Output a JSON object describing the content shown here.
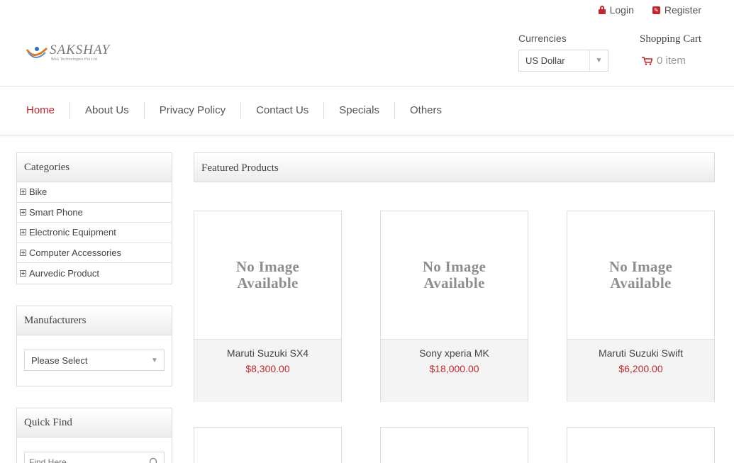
{
  "header": {
    "login_label": "Login",
    "register_label": "Register",
    "logo_text": "SAKSHAY",
    "logo_subtext": "Web Technologies Pvt Ltd",
    "currencies_label": "Currencies",
    "currency_selected": "US Dollar",
    "cart_title": "Shopping Cart",
    "cart_items": "0 item"
  },
  "nav": {
    "items": [
      "Home",
      "About Us",
      "Privacy Policy",
      "Contact Us",
      "Specials",
      "Others"
    ],
    "active": "Home"
  },
  "sidebar": {
    "categories_title": "Categories",
    "categories": [
      "Bike",
      "Smart Phone",
      "Electronic Equipment",
      "Computer Accessories",
      "Aurvedic Product"
    ],
    "manufacturers_title": "Manufacturers",
    "manufacturer_selected": "Please Select",
    "quickfind_title": "Quick Find",
    "quickfind_placeholder": "Find Here"
  },
  "featured": {
    "title": "Featured Products",
    "no_image_line1": "No Image",
    "no_image_line2": "Available",
    "products": [
      {
        "name": "Maruti Suzuki SX4",
        "price": "$8,300.00"
      },
      {
        "name": "Sony xperia MK",
        "price": "$18,000.00"
      },
      {
        "name": "Maruti Suzuki Swift",
        "price": "$6,200.00"
      }
    ]
  },
  "colors": {
    "accent": "#c0282d",
    "text": "#555555",
    "border": "#dcdcdc"
  }
}
